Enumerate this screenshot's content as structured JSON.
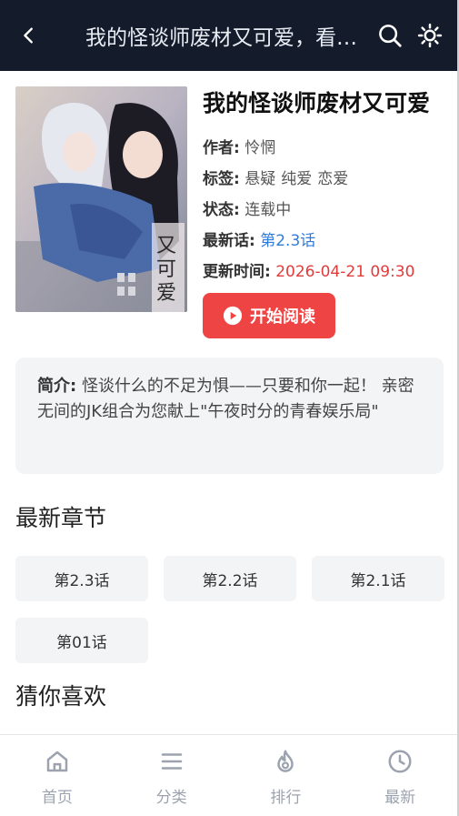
{
  "header": {
    "title": "我的怪谈师废材又可爱，看不见吗",
    "back_icon": "chevron-left-icon",
    "search_icon": "search-icon",
    "theme_icon": "sun-icon"
  },
  "book": {
    "title": "我的怪谈师废材又可爱",
    "author_label": "作者:",
    "author": "怜惘",
    "tags_label": "标签:",
    "tags": [
      "悬疑",
      "纯爱",
      "恋爱"
    ],
    "status_label": "状态:",
    "status": "连载中",
    "latest_label": "最新话:",
    "latest": "第2.3话",
    "updated_label": "更新时间:",
    "updated": "2026-04-21 09:30",
    "read_button": "开始阅读",
    "cover_text": "又可爱"
  },
  "intro": {
    "label": "简介:",
    "text": "怪谈什么的不足为惧——只要和你一起！ 亲密无间的JK组合为您献上\"午夜时分的青春娱乐局\""
  },
  "latest_section": {
    "title": "最新章节",
    "chapters": [
      "第2.3话",
      "第2.2话",
      "第2.1话",
      "第01话"
    ]
  },
  "recommend_section": {
    "title": "猜你喜欢"
  },
  "tabbar": {
    "items": [
      {
        "label": "首页",
        "icon": "home-icon"
      },
      {
        "label": "分类",
        "icon": "menu-icon"
      },
      {
        "label": "排行",
        "icon": "flame-icon"
      },
      {
        "label": "最新",
        "icon": "clock-icon"
      }
    ]
  },
  "colors": {
    "header_bg": "#141b2b",
    "accent_red": "#ef4444",
    "link_blue": "#2f7bdc",
    "panel_bg": "#f3f4f6"
  }
}
